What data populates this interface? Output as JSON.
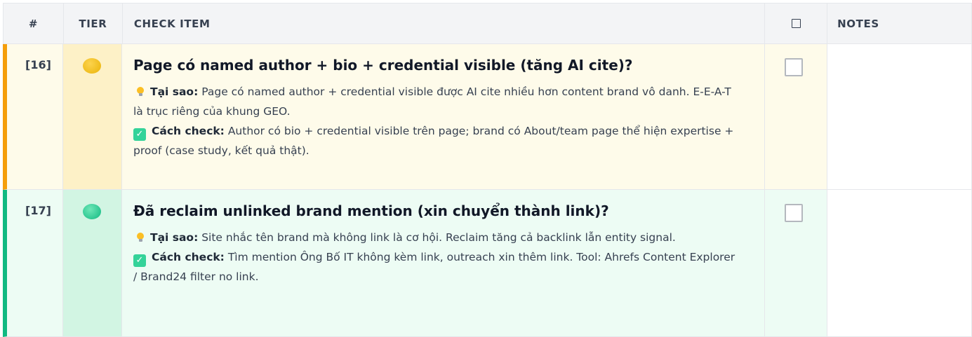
{
  "headers": {
    "num": "#",
    "tier": "TIER",
    "item": "CHECK ITEM",
    "notes": "NOTES"
  },
  "rows": [
    {
      "num": "[16]",
      "tier_color": "#eab308",
      "title": "Page có named author + bio + credential visible (tăng AI cite)?",
      "why_label": "Tại sao:",
      "why_text": " Page có named author + credential visible được AI cite nhiều hơn content brand vô danh. E-E-A-T là trục riêng của khung GEO.",
      "how_label": "Cách check:",
      "how_text": " Author có bio + credential visible trên page; brand có About/team page thể hiện expertise + proof (case study, kết quả thật).",
      "checked": false,
      "notes": ""
    },
    {
      "num": "[17]",
      "tier_color": "#10b981",
      "title": "Đã reclaim unlinked brand mention (xin chuyển thành link)?",
      "why_label": "Tại sao:",
      "why_text": " Site nhắc tên brand mà không link là cơ hội. Reclaim tăng cả backlink lẫn entity signal.",
      "how_label": "Cách check:",
      "how_text": " Tìm mention Ông Bố IT không kèm link, outreach xin thêm link. Tool: Ahrefs Content Explorer / Brand24 filter no link.",
      "checked": false,
      "notes": ""
    }
  ]
}
